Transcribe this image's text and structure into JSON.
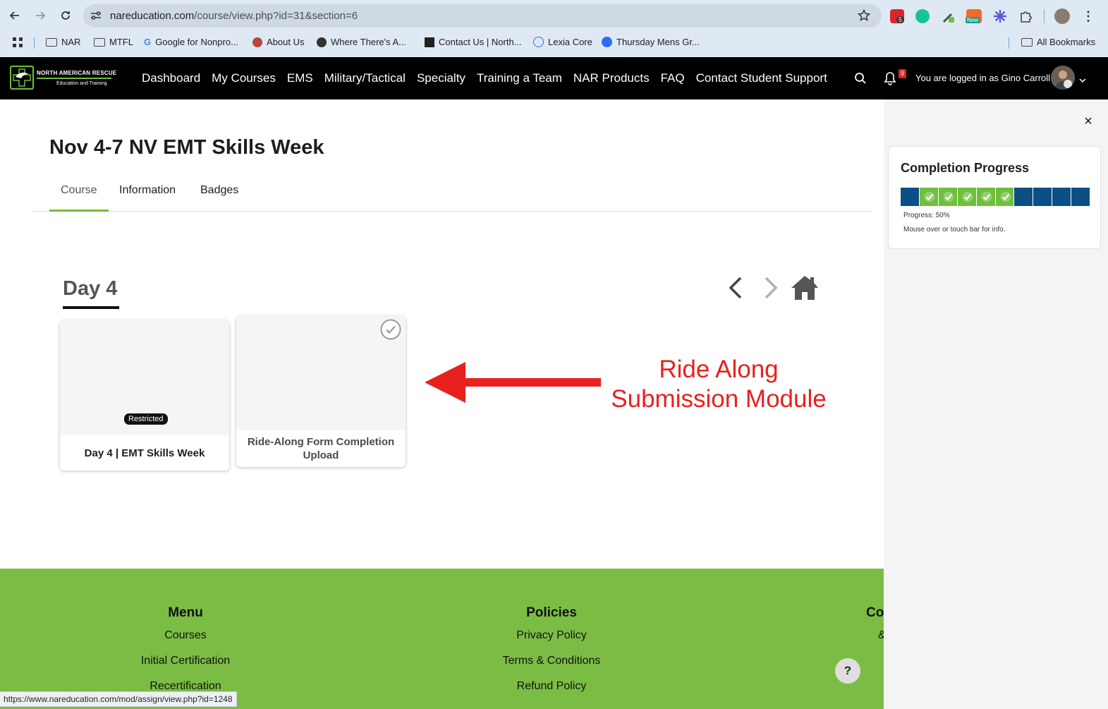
{
  "browser": {
    "url_host": "nareducation.com",
    "url_path": "/course/view.php?id=31&section=6",
    "extensions": [
      {
        "name": "pdf-extension",
        "badge": "5",
        "color": "#d9262b"
      },
      {
        "name": "grammarly-extension",
        "color": "#15c39a"
      },
      {
        "name": "pen-extension",
        "color": "#4a4a4a"
      },
      {
        "name": "new-extension",
        "badge": "New",
        "color": "#f06a2a"
      },
      {
        "name": "sparkle-extension",
        "color": "#5b5bd6"
      },
      {
        "name": "puzzle-extension",
        "color": "#444444"
      }
    ],
    "bookmarks": [
      {
        "label": "NAR",
        "icon": "folder-icon"
      },
      {
        "label": "MTFL",
        "icon": "folder-icon"
      },
      {
        "label": "Google for Nonpro...",
        "icon": "google-icon"
      },
      {
        "label": "About Us",
        "icon": "site-icon"
      },
      {
        "label": "Where There's A...",
        "icon": "globe-icon"
      },
      {
        "label": "Contact Us | North...",
        "icon": "site-icon"
      },
      {
        "label": "Lexia Core",
        "icon": "globe-icon"
      },
      {
        "label": "Thursday Mens Gr...",
        "icon": "zoom-icon"
      }
    ],
    "all_bookmarks": "All Bookmarks",
    "status_url": "https://www.nareducation.com/mod/assign/view.php?id=1248"
  },
  "header": {
    "logo_title": "NORTH AMERICAN RESCUE",
    "logo_sub": "Education and Training",
    "nav": [
      "Dashboard",
      "My Courses",
      "EMS",
      "Military/Tactical",
      "Specialty",
      "Training a Team",
      "NAR Products",
      "FAQ",
      "Contact Student Support"
    ],
    "notification_count": "9",
    "login_text": "You are logged in as Gino Carroll"
  },
  "course": {
    "title": "Nov 4-7 NV EMT Skills Week",
    "tabs": [
      "Course",
      "Information",
      "Badges"
    ],
    "section_title": "Day 4",
    "cards": [
      {
        "label": "Day 4 | EMT Skills Week",
        "badge": "Restricted"
      },
      {
        "label": "Ride-Along Form Completion Upload"
      }
    ]
  },
  "annotation": {
    "text": "Ride Along Submission Module",
    "color": "#e8211e"
  },
  "drawer": {
    "close": "×",
    "title": "Completion Progress",
    "segments": [
      false,
      true,
      true,
      true,
      true,
      true,
      false,
      false,
      false,
      false
    ],
    "progress_text": "Progress: 50%",
    "hint_text": "Mouse over or touch bar for info.",
    "complete_color": "#6fbf3c",
    "incomplete_color": "#0b4f85"
  },
  "footer": {
    "menu_title": "Menu",
    "menu_links": [
      "Courses",
      "Initial Certification",
      "Recertification"
    ],
    "policies_title": "Policies",
    "policies_links": [
      "Privacy Policy",
      "Terms & Conditions",
      "Refund Policy"
    ],
    "col3_title": "Co",
    "col3_link": "&",
    "help": "?"
  }
}
